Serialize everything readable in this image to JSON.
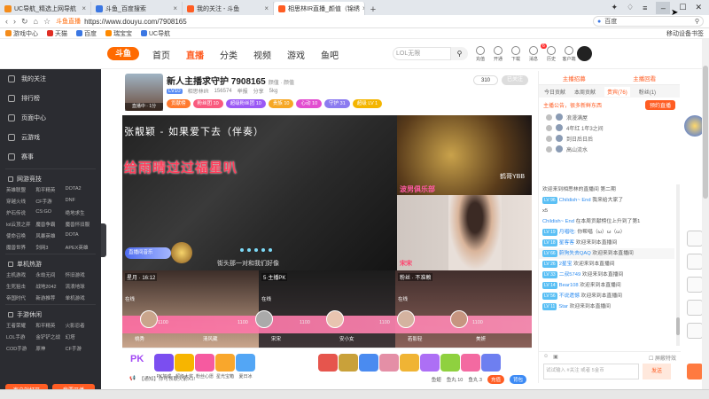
{
  "browser": {
    "tabs": [
      {
        "label": "UC导航_精选上网导航",
        "color": "#f48c1b"
      },
      {
        "label": "斗鱼_百度搜索",
        "color": "#3b77e3"
      },
      {
        "label": "我的关注 - 斗鱼",
        "color": "#ff5d23"
      },
      {
        "label": "相思林IR直播_颜值（锦绣",
        "color": "#ff5d23"
      }
    ],
    "site_badge": "斗鱼直播",
    "url": "https://www.douyu.com/7908165",
    "search_placeholder": "百度",
    "bookmarks": [
      {
        "label": "游戏中心",
        "color": "#f48c1b"
      },
      {
        "label": "天猫",
        "color": "#e02e24"
      },
      {
        "label": "百度",
        "color": "#3b77e3"
      },
      {
        "label": "瑞宝宝",
        "color": "#ff8a00"
      },
      {
        "label": "UC导航",
        "color": "#3b77e3"
      }
    ],
    "mobile_bookmarks": "移动设备书签"
  },
  "site": {
    "logo": "斗鱼",
    "nav": [
      "首页",
      "直播",
      "分类",
      "视频",
      "游戏",
      "鱼吧"
    ],
    "nav_active": "直播",
    "search_placeholder": "LOL无限",
    "top_icons": [
      "充值",
      "开通",
      "下载",
      "消息",
      "历史",
      "客户端"
    ],
    "msg_badge": "6"
  },
  "sidebar": {
    "items": [
      "我的关注",
      "排行榜",
      "页面中心",
      "云游戏"
    ],
    "extra_row": "赛事",
    "sections": [
      {
        "title": "网游竞技",
        "games": [
          "英雄联盟",
          "和平精英",
          "DOTA2",
          "穿越火线",
          "CF手游",
          "DNF",
          "炉石传说",
          "CS:GO",
          "绝地求生",
          "lol云顶之弈",
          "魔兽争霸",
          "魔兽怀旧服",
          "使命召唤",
          "风暴英雄",
          "DOTA",
          "魔兽世界",
          "剑网3",
          "APEX英雄"
        ]
      },
      {
        "title": "单机热游",
        "games": [
          "主机游戏",
          "永劫无间",
          "怀旧游戏",
          "生死狙击",
          "战地2042",
          "流浪地球",
          "帝国时代",
          "新游推荐",
          "单机游戏"
        ]
      },
      {
        "title": "手游休闲",
        "games": [
          "王者荣耀",
          "和平精英",
          "火影忍者",
          "LOL手游",
          "金铲铲之战",
          "幻塔",
          "COD手游",
          "原神",
          "CF手游"
        ]
      }
    ],
    "btn_client": "客户端打开",
    "btn_broadcast": "我要开播"
  },
  "room": {
    "title": "新人主播求守护 7908165",
    "title_sub": "颜值 · 颜值",
    "level": "LV10",
    "category": "相思林IR",
    "heat": "156574",
    "report": "举报",
    "share": "分享",
    "fans": "5kg",
    "follow_count": "310",
    "follow_btn": "已关注",
    "cover_tag": "直播中 · 1分",
    "badges": [
      {
        "label": "贡献榜",
        "color": "#ff7a2f"
      },
      {
        "label": "粉丝团 10",
        "color": "#f95a7e"
      },
      {
        "label": "超级粉丝团 10",
        "color": "#9b59f5"
      },
      {
        "label": "贵族 10",
        "color": "#f6a724"
      },
      {
        "label": "心动 10",
        "color": "#e24dd0"
      },
      {
        "label": "守护 31",
        "color": "#8c7bf0"
      },
      {
        "label": "超级 LV 1",
        "color": "#f4b500"
      }
    ]
  },
  "stream": {
    "song_title": "张靓颖 - 如果爱下去（伴奏）",
    "red_caption": "给雨晴过过福星叭",
    "side_name": "鹤哥YBB",
    "side_name2": "波男俱乐部",
    "side_name3": "宋宋",
    "location": "直播间音乐",
    "sub_caption": "街头那一对和我们好像",
    "bottom_captions": [
      {
        "title": "星月 · 16:12",
        "sub": "在线"
      },
      {
        "title": "5·主播PK",
        "sub": "在线"
      },
      {
        "title": "粉丝 · 不准赖",
        "sub": "在线"
      }
    ],
    "pk_counts": [
      "1100",
      "1100",
      "1100",
      "1100",
      "1100"
    ],
    "pk_names": [
      "桃秀",
      "清风藏",
      "宋宋",
      "安小女",
      "若影轻",
      "美妍"
    ]
  },
  "footer": {
    "pk_label": "PK",
    "gifts": [
      {
        "label": "PK加成",
        "color": "#7b4ef0"
      },
      {
        "label": "超级大奖",
        "color": "#f7b500"
      },
      {
        "label": "粉丝心愿",
        "color": "#f65aa0"
      },
      {
        "label": "星光宝箱",
        "color": "#f9a72c"
      },
      {
        "label": "夏日冰",
        "color": "#53a6f5"
      },
      {
        "label": "幸运宝",
        "color": "#e6554d"
      },
      {
        "label": "火箭",
        "color": "#c9a13a"
      },
      {
        "label": "飞机",
        "color": "#4a8bf0"
      },
      {
        "label": "棒棒",
        "color": "#e48fa6"
      },
      {
        "label": "666",
        "color": "#f0b434"
      },
      {
        "label": "办卡",
        "color": "#ad6ff5"
      },
      {
        "label": "荧光棒",
        "color": "#8fd13f"
      },
      {
        "label": "小心心",
        "color": "#f36aa1"
      },
      {
        "label": "鲜花",
        "color": "#6e7ff0"
      }
    ],
    "notice": "【通知】你可领取火箭X1!",
    "stats": [
      "鱼翅",
      "鱼丸 10",
      "鱼丸 3"
    ],
    "recharge": "充值",
    "bag": "背包"
  },
  "chat": {
    "top_left": "主播招募",
    "top_right": "主播回看",
    "tabs": [
      "今日贡献",
      "本周贡献",
      "贵宾(76)",
      "粉丝(1)"
    ],
    "active_tab": "贵宾(76)",
    "announcement": "主播公告，很多新鲜东西",
    "announcement_btn": "预约直播",
    "ranks": [
      "浪漫满屋",
      "4年红 1年3之间",
      "到日后日后",
      "高山流水"
    ],
    "messages": [
      {
        "lv": "",
        "name": "",
        "text": "欢迎来到相思林的直播间 第二期"
      },
      {
        "lv": "LV 96",
        "name": "Childish~ End",
        "text": "我来给大家了"
      },
      {
        "lv": "",
        "name": "",
        "text": "x5"
      },
      {
        "lv": "",
        "name": "Childish~ End",
        "text": "在本周贡献榜位上升到了第1"
      },
      {
        "lv": "LV 19",
        "name": "月唱吃:",
        "text": "你帮唱（ω）ω（ω）"
      },
      {
        "lv": "LV 18",
        "name": "星客客",
        "text": "欢迎来到本直播间"
      },
      {
        "lv": "LV 66",
        "name": "蔚狗失去QAQ",
        "text": "欢迎来到本直播间"
      },
      {
        "lv": "LV 26",
        "name": "2星宝",
        "text": "欢迎来到本直播间"
      },
      {
        "lv": "LV 33",
        "name": "二叔5749",
        "text": "欢迎来到本直播间"
      },
      {
        "lv": "LV 14",
        "name": "Bear108",
        "text": "欢迎来到本直播间"
      },
      {
        "lv": "LV 56",
        "name": "不说遗憾",
        "text": "欢迎来到本直播间"
      },
      {
        "lv": "LV 11",
        "name": "Star",
        "text": "欢迎来到本直播间"
      }
    ],
    "input_placeholder": "试试输入 #关注 或者 5金币",
    "send": "发送",
    "checkbox_label": "屏蔽特效"
  }
}
